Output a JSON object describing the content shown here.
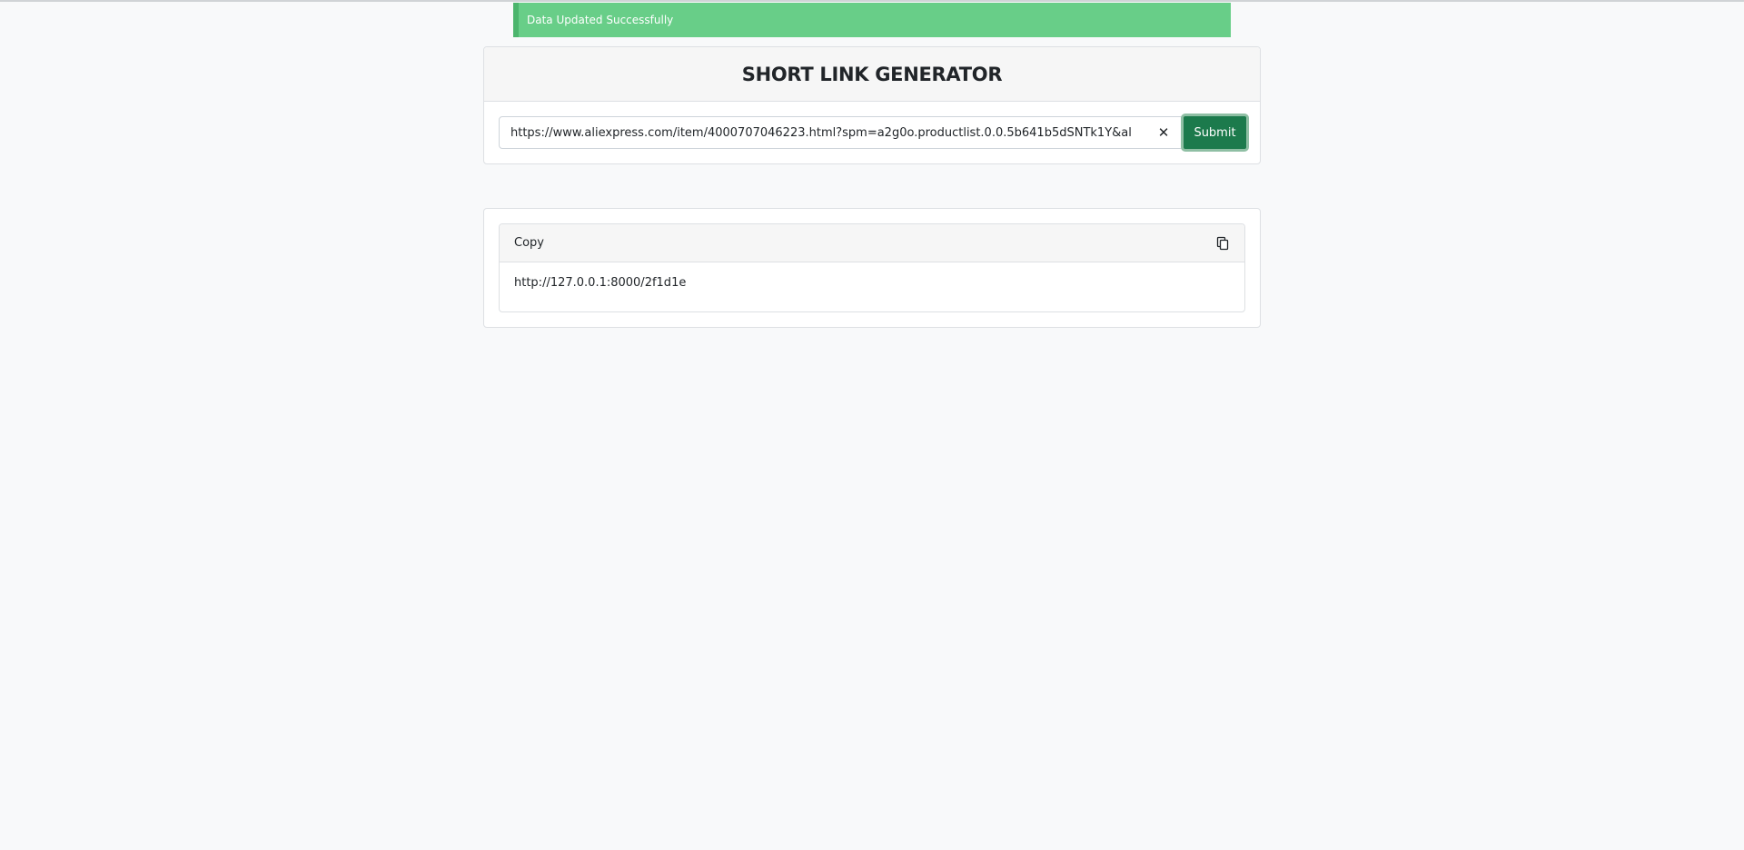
{
  "alert": {
    "message": "Data Updated Successfully",
    "color": "#68ce88"
  },
  "generator": {
    "title": "SHORT LINK GENERATOR",
    "url_value": "https://www.aliexpress.com/item/4000707046223.html?spm=a2g0o.productlist.0.0.5b641b5dSNTk1Y&al",
    "clear_icon": "close-icon",
    "submit_label": "Submit",
    "accent": "#1c7a4c"
  },
  "result": {
    "header_label": "Copy",
    "copy_icon": "copy-icon",
    "short_url": "http://127.0.0.1:8000/2f1d1e"
  }
}
